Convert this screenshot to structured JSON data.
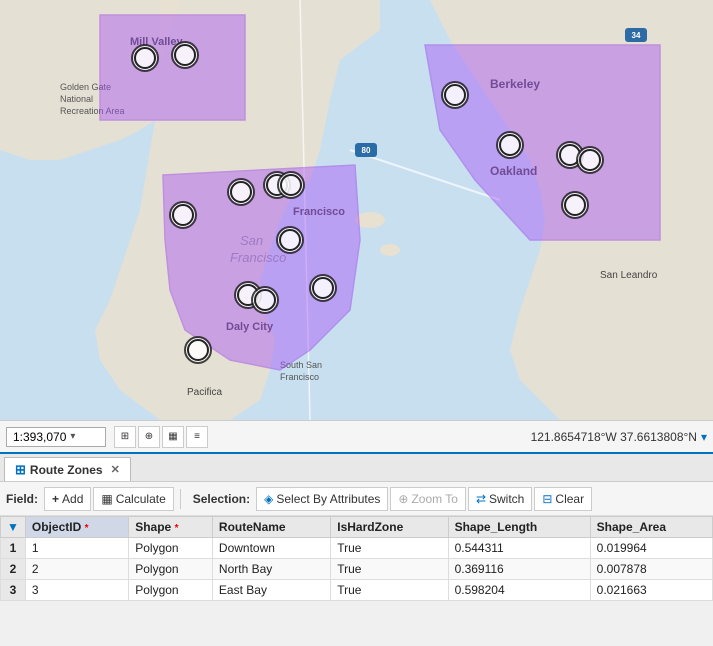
{
  "map": {
    "scale": "1:393,070",
    "coords": "121.8654718°W 37.6613808°N"
  },
  "toolbar": {
    "scale_label": "1:393,070"
  },
  "table": {
    "tab_label": "Route Zones",
    "field_label": "Field:",
    "add_label": "Add",
    "calculate_label": "Calculate",
    "selection_label": "Selection:",
    "select_by_attributes_label": "Select By Attributes",
    "zoom_to_label": "Zoom To",
    "switch_label": "Switch",
    "clear_label": "Clear",
    "columns": [
      "ObjectID *",
      "Shape *",
      "RouteName",
      "IsHardZone",
      "Shape_Length",
      "Shape_Area"
    ],
    "rows": [
      {
        "num": "1",
        "ObjectID": "1",
        "Shape": "Polygon",
        "RouteName": "Downtown",
        "IsHardZone": "True",
        "Shape_Length": "0.544311",
        "Shape_Area": "0.019964"
      },
      {
        "num": "2",
        "ObjectID": "2",
        "Shape": "Polygon",
        "RouteName": "North Bay",
        "IsHardZone": "True",
        "Shape_Length": "0.369116",
        "Shape_Area": "0.007878"
      },
      {
        "num": "3",
        "ObjectID": "3",
        "Shape": "Polygon",
        "RouteName": "East Bay",
        "IsHardZone": "True",
        "Shape_Length": "0.598204",
        "Shape_Area": "0.021663"
      }
    ]
  },
  "icons": {
    "grid": "⊞",
    "chevron_down": "▾",
    "close": "✕",
    "table_icon": "▦",
    "add_icon": "+",
    "calc_icon": "=",
    "select_icon": "◈",
    "zoom_icon": "⊕",
    "switch_icon": "⇄",
    "clear_icon": "⊟"
  }
}
